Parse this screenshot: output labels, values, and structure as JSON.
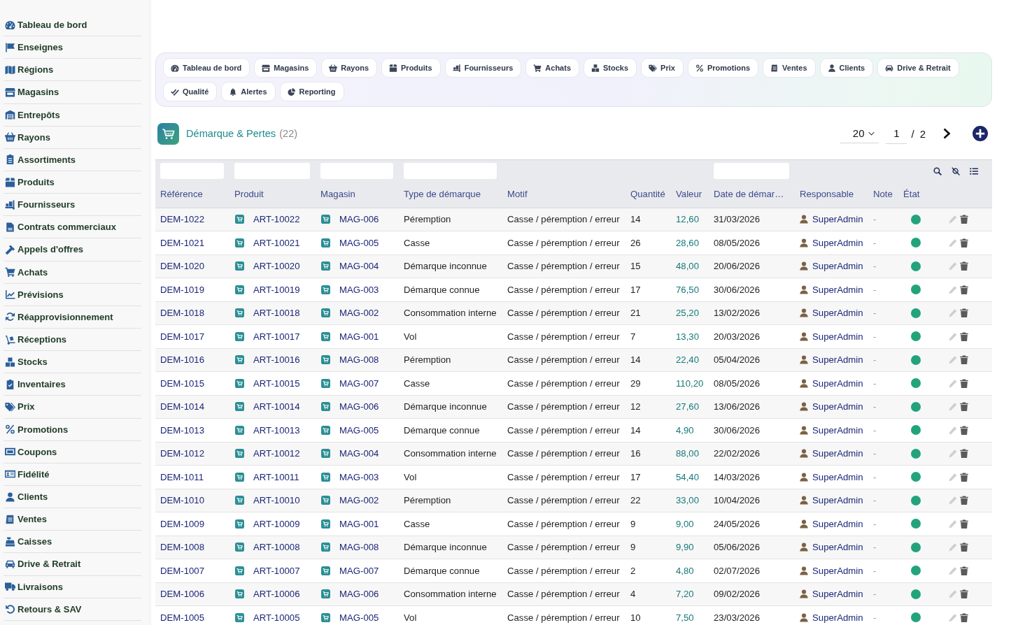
{
  "sidebar": {
    "items": [
      {
        "label": "Tableau de bord"
      },
      {
        "label": "Enseignes"
      },
      {
        "label": "Régions"
      },
      {
        "label": "Magasins"
      },
      {
        "label": "Entrepôts"
      },
      {
        "label": "Rayons"
      },
      {
        "label": "Assortiments"
      },
      {
        "label": "Produits"
      },
      {
        "label": "Fournisseurs"
      },
      {
        "label": "Contrats commerciaux"
      },
      {
        "label": "Appels d'offres"
      },
      {
        "label": "Achats"
      },
      {
        "label": "Prévisions"
      },
      {
        "label": "Réapprovisionnement"
      },
      {
        "label": "Réceptions"
      },
      {
        "label": "Stocks"
      },
      {
        "label": "Inventaires"
      },
      {
        "label": "Prix"
      },
      {
        "label": "Promotions"
      },
      {
        "label": "Coupons"
      },
      {
        "label": "Fidélité"
      },
      {
        "label": "Clients"
      },
      {
        "label": "Ventes"
      },
      {
        "label": "Caisses"
      },
      {
        "label": "Drive & Retrait"
      },
      {
        "label": "Livraisons"
      },
      {
        "label": "Retours & SAV"
      }
    ]
  },
  "nav_tabs": [
    {
      "label": "Tableau de bord"
    },
    {
      "label": "Magasins"
    },
    {
      "label": "Rayons"
    },
    {
      "label": "Produits"
    },
    {
      "label": "Fournisseurs"
    },
    {
      "label": "Achats"
    },
    {
      "label": "Stocks"
    },
    {
      "label": "Prix"
    },
    {
      "label": "Promotions"
    },
    {
      "label": "Ventes"
    },
    {
      "label": "Clients"
    },
    {
      "label": "Drive & Retrait"
    },
    {
      "label": "Qualité"
    },
    {
      "label": "Alertes"
    },
    {
      "label": "Reporting"
    }
  ],
  "page_header": {
    "title": "Démarque & Pertes",
    "count": "(22)"
  },
  "pagination": {
    "page_size": "20",
    "page": "1",
    "separator": "/",
    "total_pages": "2"
  },
  "table": {
    "columns": [
      {
        "label": "Référence",
        "filter": true
      },
      {
        "label": "Produit",
        "filter": true
      },
      {
        "label": "Magasin",
        "filter": true
      },
      {
        "label": "Type de démarque",
        "filter": true
      },
      {
        "label": "Motif",
        "filter": false
      },
      {
        "label": "Quantité",
        "filter": false
      },
      {
        "label": "Valeur",
        "filter": false
      },
      {
        "label": "Date de démar…",
        "filter": true
      },
      {
        "label": "Responsable",
        "filter": false
      },
      {
        "label": "Note",
        "filter": false
      },
      {
        "label": "État",
        "filter": false
      }
    ],
    "rows": [
      {
        "reference": "DEM-1022",
        "product": "ART-10022",
        "store": "MAG-006",
        "type": "Péremption",
        "reason": "Casse / péremption / erreur",
        "quantity": "14",
        "value": "12,60",
        "date": "31/03/2026",
        "owner": "SuperAdmin",
        "note": "-",
        "color": "#22a37b"
      },
      {
        "reference": "DEM-1021",
        "product": "ART-10021",
        "store": "MAG-005",
        "type": "Casse",
        "reason": "Casse / péremption / erreur",
        "quantity": "26",
        "value": "28,60",
        "date": "08/05/2026",
        "owner": "SuperAdmin",
        "note": "-",
        "color": "#22a37b"
      },
      {
        "reference": "DEM-1020",
        "product": "ART-10020",
        "store": "MAG-004",
        "type": "Démarque inconnue",
        "reason": "Casse / péremption / erreur",
        "quantity": "15",
        "value": "48,00",
        "date": "20/06/2026",
        "owner": "SuperAdmin",
        "note": "-",
        "color": "#22a37b"
      },
      {
        "reference": "DEM-1019",
        "product": "ART-10019",
        "store": "MAG-003",
        "type": "Démarque connue",
        "reason": "Casse / péremption / erreur",
        "quantity": "17",
        "value": "76,50",
        "date": "30/06/2026",
        "owner": "SuperAdmin",
        "note": "-",
        "color": "#22a37b"
      },
      {
        "reference": "DEM-1018",
        "product": "ART-10018",
        "store": "MAG-002",
        "type": "Consommation interne",
        "reason": "Casse / péremption / erreur",
        "quantity": "21",
        "value": "25,20",
        "date": "13/02/2026",
        "owner": "SuperAdmin",
        "note": "-",
        "color": "#22a37b"
      },
      {
        "reference": "DEM-1017",
        "product": "ART-10017",
        "store": "MAG-001",
        "type": "Vol",
        "reason": "Casse / péremption / erreur",
        "quantity": "7",
        "value": "13,30",
        "date": "20/03/2026",
        "owner": "SuperAdmin",
        "note": "-",
        "color": "#22a37b"
      },
      {
        "reference": "DEM-1016",
        "product": "ART-10016",
        "store": "MAG-008",
        "type": "Péremption",
        "reason": "Casse / péremption / erreur",
        "quantity": "14",
        "value": "22,40",
        "date": "05/04/2026",
        "owner": "SuperAdmin",
        "note": "-",
        "color": "#22a37b"
      },
      {
        "reference": "DEM-1015",
        "product": "ART-10015",
        "store": "MAG-007",
        "type": "Casse",
        "reason": "Casse / péremption / erreur",
        "quantity": "29",
        "value": "110,20",
        "date": "08/05/2026",
        "owner": "SuperAdmin",
        "note": "-",
        "color": "#22a37b"
      },
      {
        "reference": "DEM-1014",
        "product": "ART-10014",
        "store": "MAG-006",
        "type": "Démarque inconnue",
        "reason": "Casse / péremption / erreur",
        "quantity": "12",
        "value": "27,60",
        "date": "13/06/2026",
        "owner": "SuperAdmin",
        "note": "-",
        "color": "#22a37b"
      },
      {
        "reference": "DEM-1013",
        "product": "ART-10013",
        "store": "MAG-005",
        "type": "Démarque connue",
        "reason": "Casse / péremption / erreur",
        "quantity": "14",
        "value": "4,90",
        "date": "30/06/2026",
        "owner": "SuperAdmin",
        "note": "-",
        "color": "#22a37b"
      },
      {
        "reference": "DEM-1012",
        "product": "ART-10012",
        "store": "MAG-004",
        "type": "Consommation interne",
        "reason": "Casse / péremption / erreur",
        "quantity": "16",
        "value": "88,00",
        "date": "22/02/2026",
        "owner": "SuperAdmin",
        "note": "-",
        "color": "#22a37b"
      },
      {
        "reference": "DEM-1011",
        "product": "ART-10011",
        "store": "MAG-003",
        "type": "Vol",
        "reason": "Casse / péremption / erreur",
        "quantity": "17",
        "value": "54,40",
        "date": "14/03/2026",
        "owner": "SuperAdmin",
        "note": "-",
        "color": "#22a37b"
      },
      {
        "reference": "DEM-1010",
        "product": "ART-10010",
        "store": "MAG-002",
        "type": "Péremption",
        "reason": "Casse / péremption / erreur",
        "quantity": "22",
        "value": "33,00",
        "date": "10/04/2026",
        "owner": "SuperAdmin",
        "note": "-",
        "color": "#22a37b"
      },
      {
        "reference": "DEM-1009",
        "product": "ART-10009",
        "store": "MAG-001",
        "type": "Casse",
        "reason": "Casse / péremption / erreur",
        "quantity": "9",
        "value": "9,00",
        "date": "24/05/2026",
        "owner": "SuperAdmin",
        "note": "-",
        "color": "#22a37b"
      },
      {
        "reference": "DEM-1008",
        "product": "ART-10008",
        "store": "MAG-008",
        "type": "Démarque inconnue",
        "reason": "Casse / péremption / erreur",
        "quantity": "9",
        "value": "9,90",
        "date": "05/06/2026",
        "owner": "SuperAdmin",
        "note": "-",
        "color": "#22a37b"
      },
      {
        "reference": "DEM-1007",
        "product": "ART-10007",
        "store": "MAG-007",
        "type": "Démarque connue",
        "reason": "Casse / péremption / erreur",
        "quantity": "2",
        "value": "4,80",
        "date": "02/07/2026",
        "owner": "SuperAdmin",
        "note": "-",
        "color": "#22a37b"
      },
      {
        "reference": "DEM-1006",
        "product": "ART-10006",
        "store": "MAG-006",
        "type": "Consommation interne",
        "reason": "Casse / péremption / erreur",
        "quantity": "4",
        "value": "7,20",
        "date": "09/02/2026",
        "owner": "SuperAdmin",
        "note": "-",
        "color": "#22a37b"
      },
      {
        "reference": "DEM-1005",
        "product": "ART-10005",
        "store": "MAG-005",
        "type": "Vol",
        "reason": "Casse / péremption / erreur",
        "quantity": "10",
        "value": "7,50",
        "date": "23/03/2026",
        "owner": "SuperAdmin",
        "note": "-",
        "color": "#22a37b"
      }
    ]
  }
}
